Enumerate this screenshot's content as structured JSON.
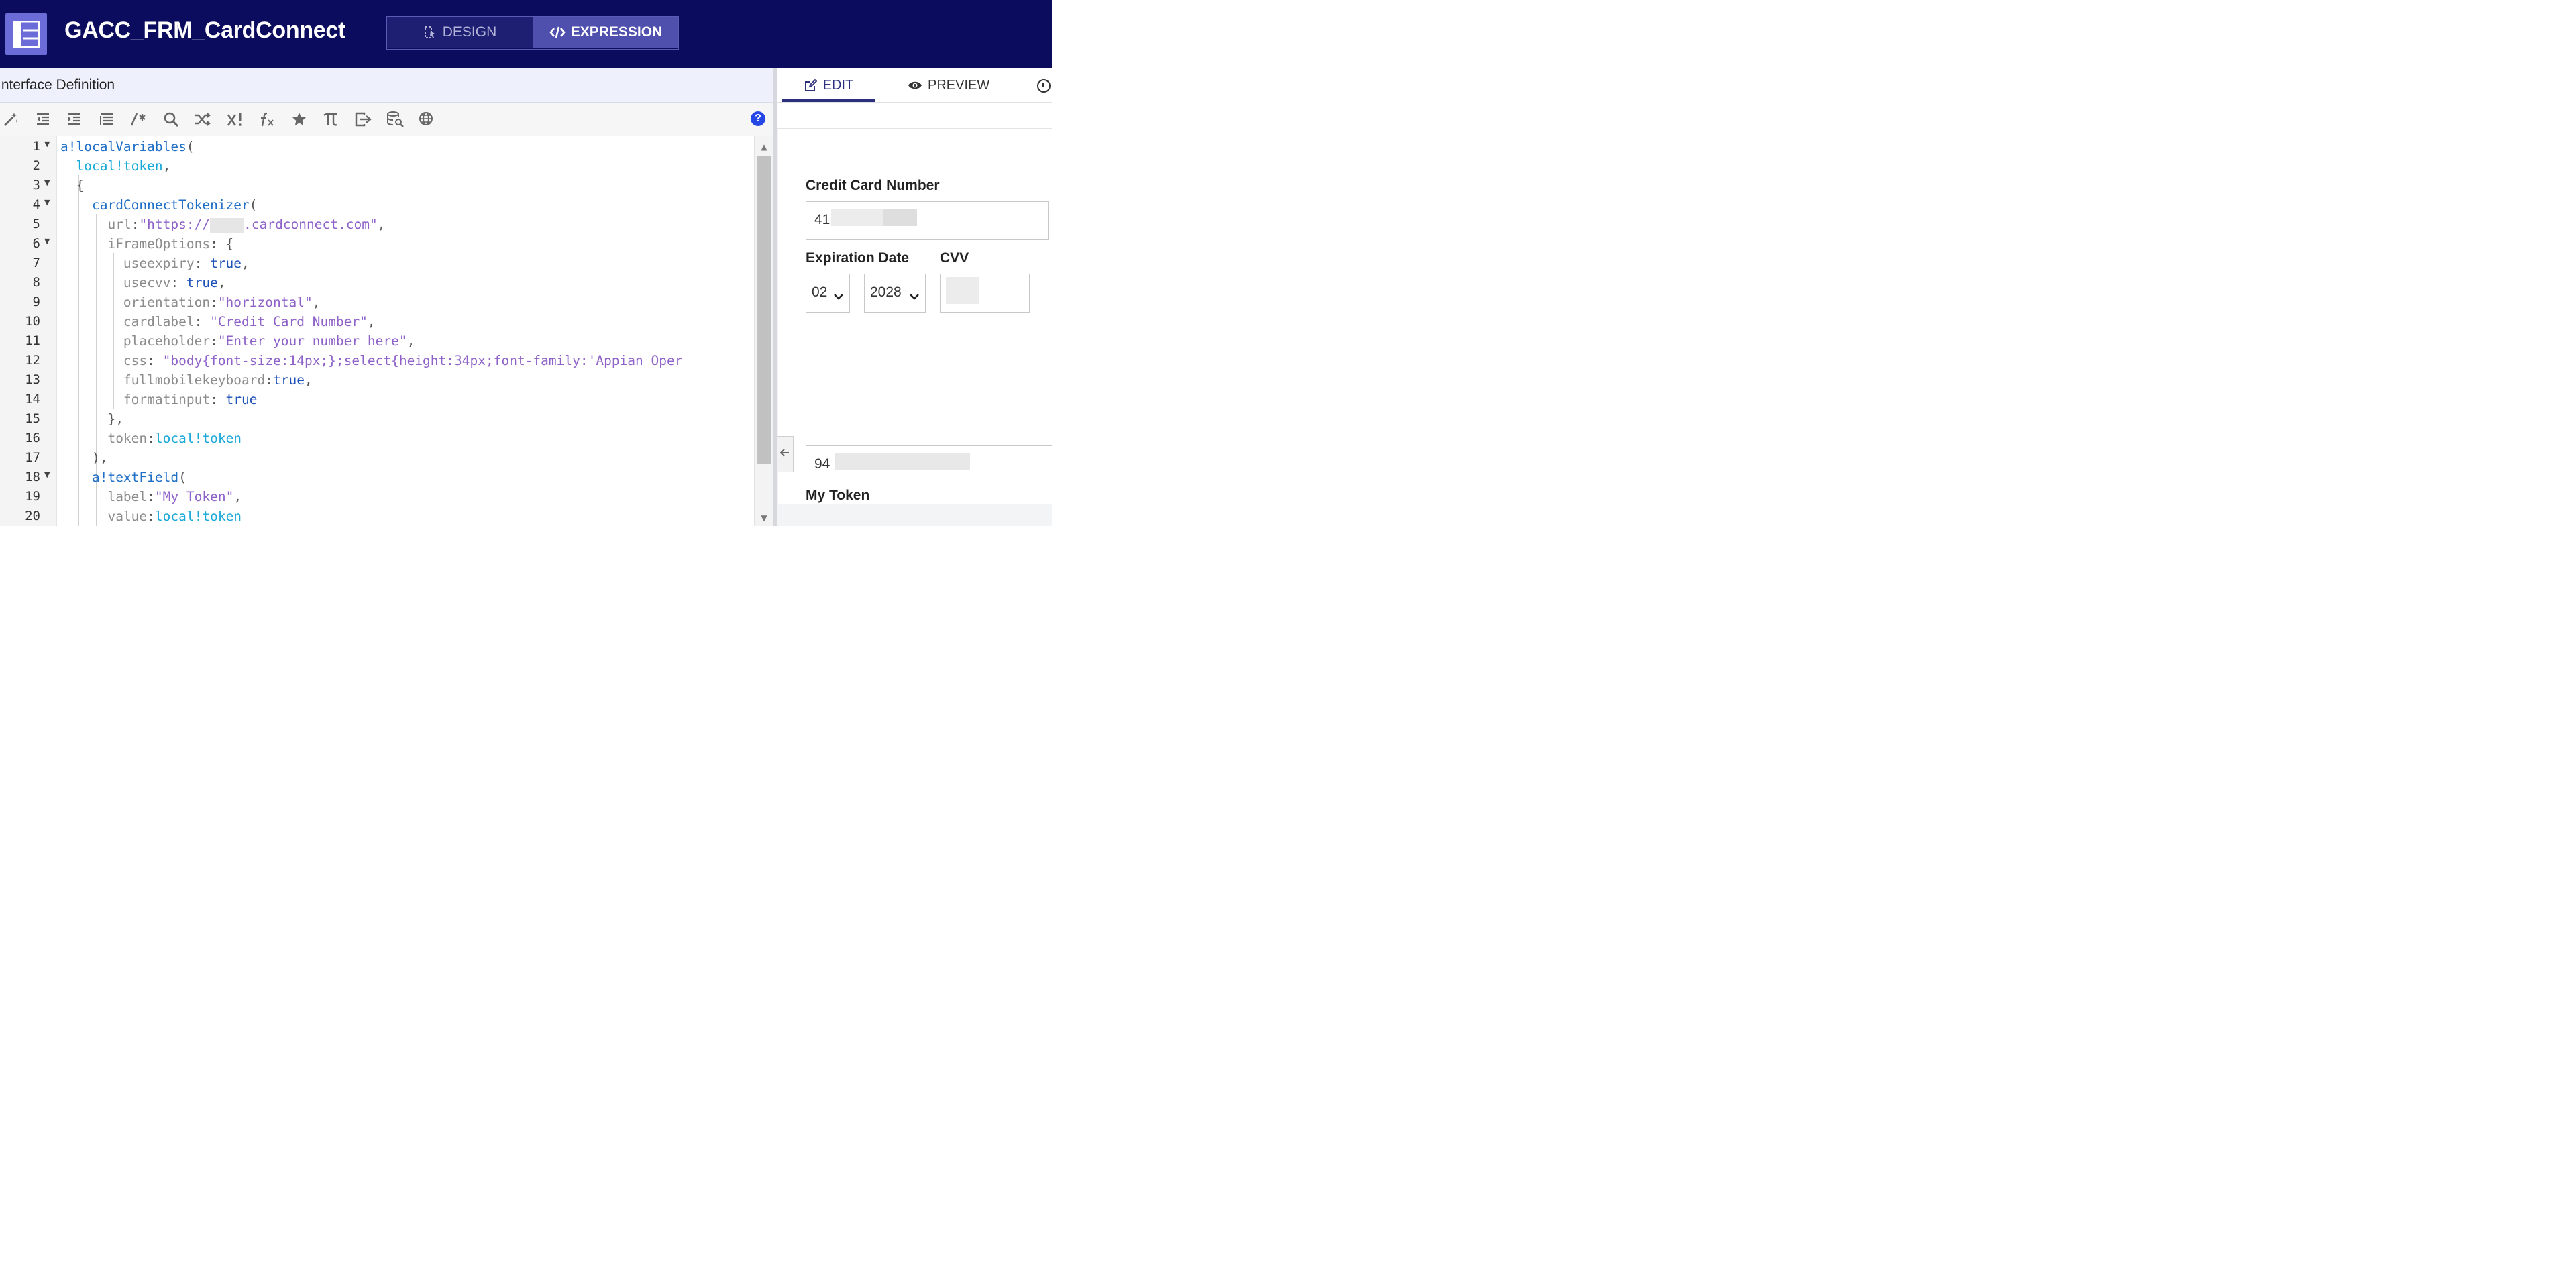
{
  "header": {
    "title": "GACC_FRM_CardConnect",
    "modes": {
      "design": "DESIGN",
      "expression": "EXPRESSION"
    },
    "active_mode": "expression",
    "colors": {
      "background": "#0b0c5e",
      "active_mode_bg": "#4f50ad"
    }
  },
  "editor_panel": {
    "title": "Interface Definition",
    "toolbar_icons": [
      "magic-wand-icon",
      "outdent-icon",
      "indent-icon",
      "format-icon",
      "comment-icon",
      "search-icon",
      "shuffle-icon",
      "rule-icon",
      "function-icon",
      "star-icon",
      "pi-icon",
      "export-icon",
      "data-search-icon",
      "globe-icon"
    ],
    "help_label": "?",
    "code": {
      "line_numbers": [
        "1",
        "2",
        "3",
        "4",
        "5",
        "6",
        "7",
        "8",
        "9",
        "10",
        "11",
        "12",
        "13",
        "14",
        "15",
        "16",
        "17",
        "18",
        "19",
        "20"
      ],
      "foldable_lines": [
        1,
        3,
        4,
        6,
        18
      ],
      "tokens": {
        "l1_fn": "a!localVariables",
        "l1_p": "(",
        "l2_var": "local!token",
        "l2_p": ",",
        "l3_p": "{",
        "l4_fn": "cardConnectTokenizer",
        "l4_p": "(",
        "l5_key": "url",
        "l5_colon": ":",
        "l5_str_a": "\"https://",
        "l5_str_b": ".cardconnect.com\"",
        "l5_p": ",",
        "l6_key": "iFrameOptions",
        "l6_p": ": {",
        "l7_key": "useexpiry",
        "l7_colon": ": ",
        "l7_kw": "true",
        "l7_p": ",",
        "l8_key": "usecvv",
        "l8_colon": ": ",
        "l8_kw": "true",
        "l8_p": ",",
        "l9_key": "orientation",
        "l9_colon": ":",
        "l9_str": "\"horizontal\"",
        "l9_p": ",",
        "l10_key": "cardlabel",
        "l10_colon": ": ",
        "l10_str": "\"Credit Card Number\"",
        "l10_p": ",",
        "l11_key": "placeholder",
        "l11_colon": ":",
        "l11_str": "\"Enter your number here\"",
        "l11_p": ",",
        "l12_key": "css",
        "l12_colon": ": ",
        "l12_str": "\"body{font-size:14px;};select{height:34px;font-family:'Appian Oper",
        "l13_key": "fullmobilekeyboard",
        "l13_colon": ":",
        "l13_kw": "true",
        "l13_p": ",",
        "l14_key": "formatinput",
        "l14_colon": ": ",
        "l14_kw": "true",
        "l15_p": "},",
        "l16_key": "token",
        "l16_colon": ":",
        "l16_var": "local!token",
        "l17_p": "),",
        "l18_fn": "a!textField",
        "l18_p": "(",
        "l19_key": "label",
        "l19_colon": ":",
        "l19_str": "\"My Token\"",
        "l19_p": ",",
        "l20_key": "value",
        "l20_colon": ":",
        "l20_var": "local!token"
      }
    }
  },
  "right_panel": {
    "tabs": {
      "edit": "EDIT",
      "preview": "PREVIEW"
    },
    "active_tab": "edit",
    "preview": {
      "card_number": {
        "label": "Credit Card Number",
        "value_visible": "41"
      },
      "expiration": {
        "label": "Expiration Date",
        "month": "02",
        "year": "2028"
      },
      "cvv": {
        "label": "CVV"
      },
      "token": {
        "label": "My Token",
        "value_visible": "94"
      }
    }
  }
}
